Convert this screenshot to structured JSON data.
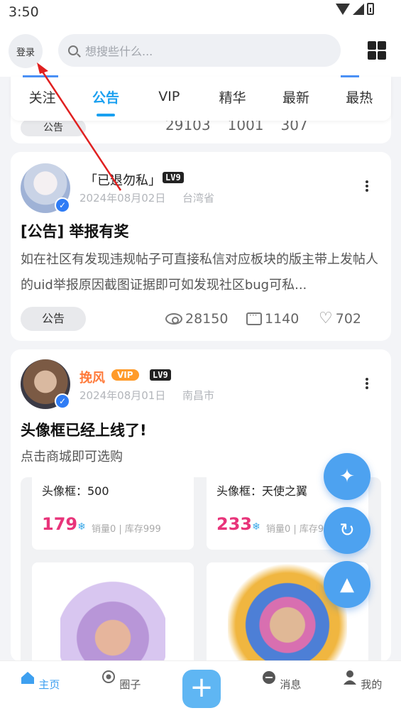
{
  "status": {
    "time": "3:50"
  },
  "header": {
    "login_label": "登录",
    "search_placeholder": "想搜些什么..."
  },
  "tabs": [
    {
      "label": "关注"
    },
    {
      "label": "公告"
    },
    {
      "label": "VIP"
    },
    {
      "label": "精华"
    },
    {
      "label": "最新"
    },
    {
      "label": "最热"
    }
  ],
  "prev_card": {
    "tag": "公告",
    "views": "29103",
    "comments": "1001",
    "likes": "307"
  },
  "posts": [
    {
      "author": "「已退勿私」",
      "level": "LV9",
      "date": "2024年08月02日",
      "location": "台湾省",
      "title": "[公告] 举报有奖",
      "body": "如在社区有发现违规帖子可直接私信对应板块的版主带上发帖人的uid举报原因截图证据即可如发现社区bug可私...",
      "tag": "公告",
      "views": "28150",
      "comments": "1140",
      "likes": "702"
    },
    {
      "author": "挽风",
      "vip": "VIP",
      "level": "LV9",
      "date": "2024年08月01日",
      "location": "南昌市",
      "title": "头像框已经上线了!",
      "body": "点击商城即可选购",
      "products": [
        {
          "name": "头像框：500",
          "price": "179",
          "meta": "销量0 | 库存999"
        },
        {
          "name": "头像框：天使之翼",
          "price": "233",
          "meta": "销量0 | 库存99"
        }
      ]
    }
  ],
  "nav": [
    {
      "label": "主页"
    },
    {
      "label": "圈子"
    },
    {
      "label": "消息"
    },
    {
      "label": "我的"
    }
  ],
  "colors": {
    "accent": "#1aa0f0",
    "price": "#e8347a",
    "fab": "#4da2f0"
  }
}
